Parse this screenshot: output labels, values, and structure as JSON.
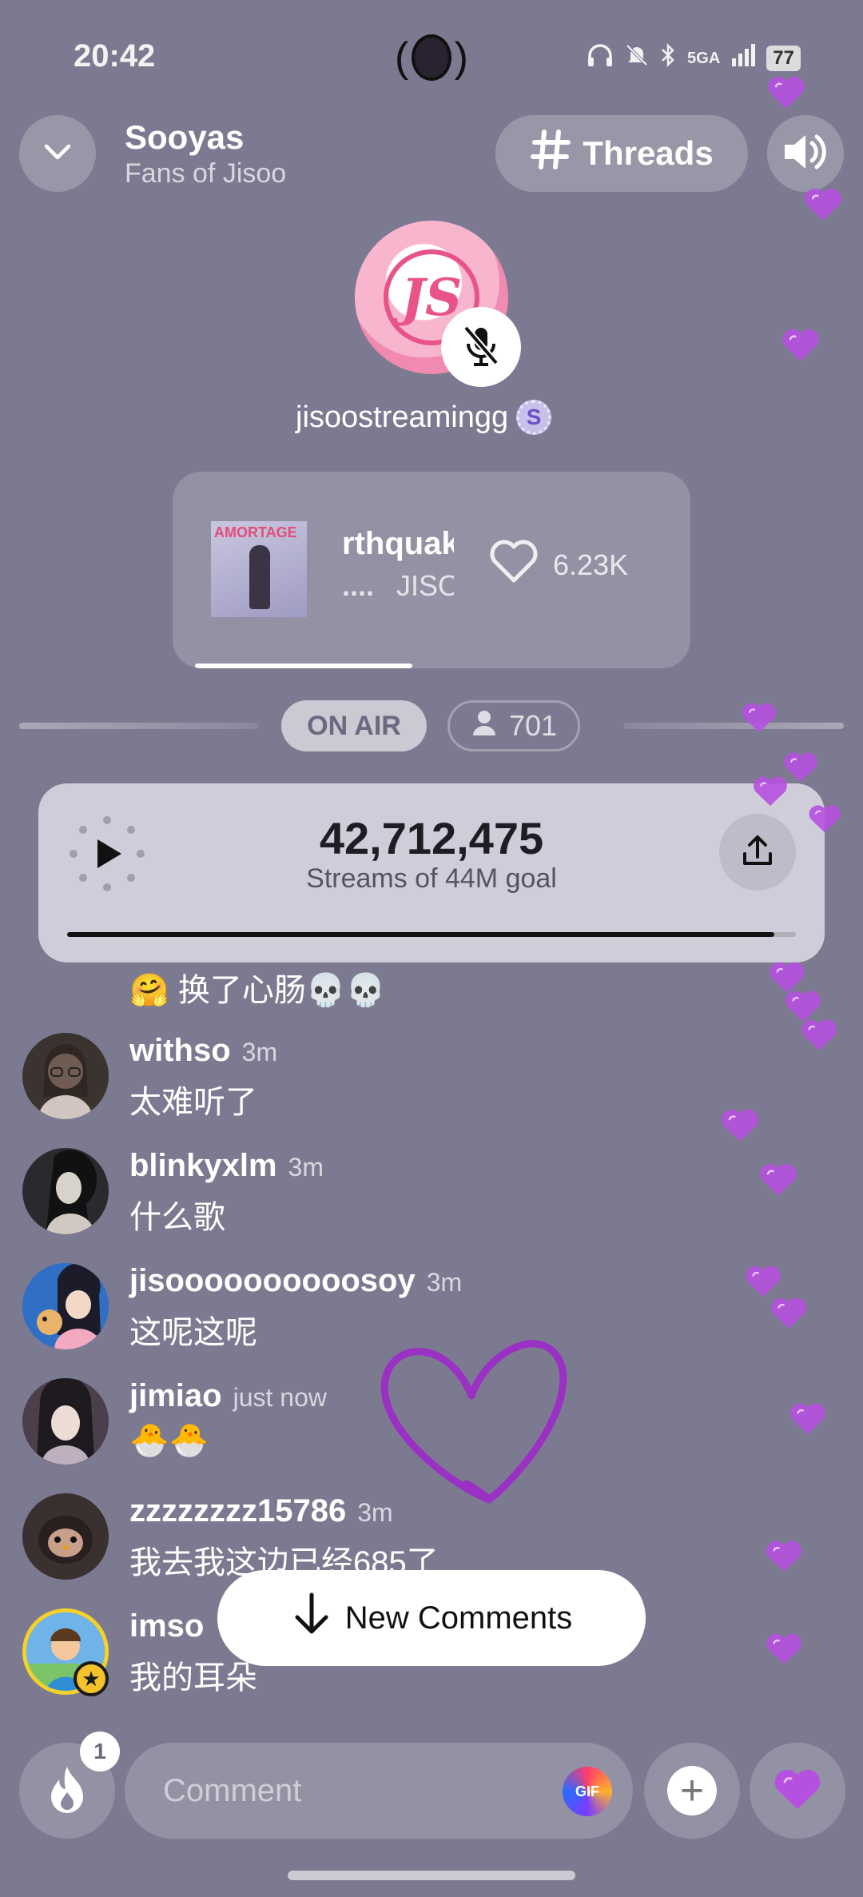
{
  "status_bar": {
    "time": "20:42",
    "network": "5GA",
    "battery": "77"
  },
  "header": {
    "room_title": "Sooyas",
    "room_subtitle": "Fans of Jisoo",
    "threads_label": "Threads",
    "back_icon": "chevron-down-icon",
    "sound_icon": "speaker-icon"
  },
  "host": {
    "name": "jisoostreamingg",
    "logo_text": "JS",
    "muted": true
  },
  "now_playing": {
    "album_text": "AMORTAGE",
    "title_visible": "rthquak",
    "artist_visible": "JISO",
    "artist_prefix": "....",
    "likes": "6.23K",
    "progress": 0.46
  },
  "live": {
    "on_air_label": "ON AIR",
    "listeners": "701"
  },
  "stream_counter": {
    "count": "42,712,475",
    "goal_text": "Streams of 44M goal",
    "progress": 0.97
  },
  "partial_comment": {
    "text": "🤗 换了心肠💀💀"
  },
  "comments": [
    {
      "user": "withso",
      "time": "3m",
      "text": "太难听了",
      "avatar_color": "#3b3330"
    },
    {
      "user": "blinkyxlm",
      "time": "3m",
      "text": "什么歌",
      "avatar_color": "#2a2a2e"
    },
    {
      "user": "jisoooooooooosoy",
      "time": "3m",
      "text": "这呢这呢",
      "avatar_color": "#2f6fc6"
    },
    {
      "user": "jimiao",
      "time": "just now",
      "text": "🐣🐣",
      "avatar_color": "#4a3f4a"
    },
    {
      "user": "zzzzzzzz15786",
      "time": "3m",
      "text": "我去我这边已经685了",
      "avatar_color": "#3a3030"
    },
    {
      "user": "imso",
      "time": "",
      "text": "我的耳朵",
      "avatar_color": "#6fb4e8"
    }
  ],
  "new_comments_label": "New Comments",
  "composer": {
    "placeholder": "Comment",
    "gif_label": "GIF",
    "notification_count": "1"
  },
  "colors": {
    "background": "#7c7a90",
    "heart": "#b650e0",
    "accent_pink": "#e8538a"
  }
}
